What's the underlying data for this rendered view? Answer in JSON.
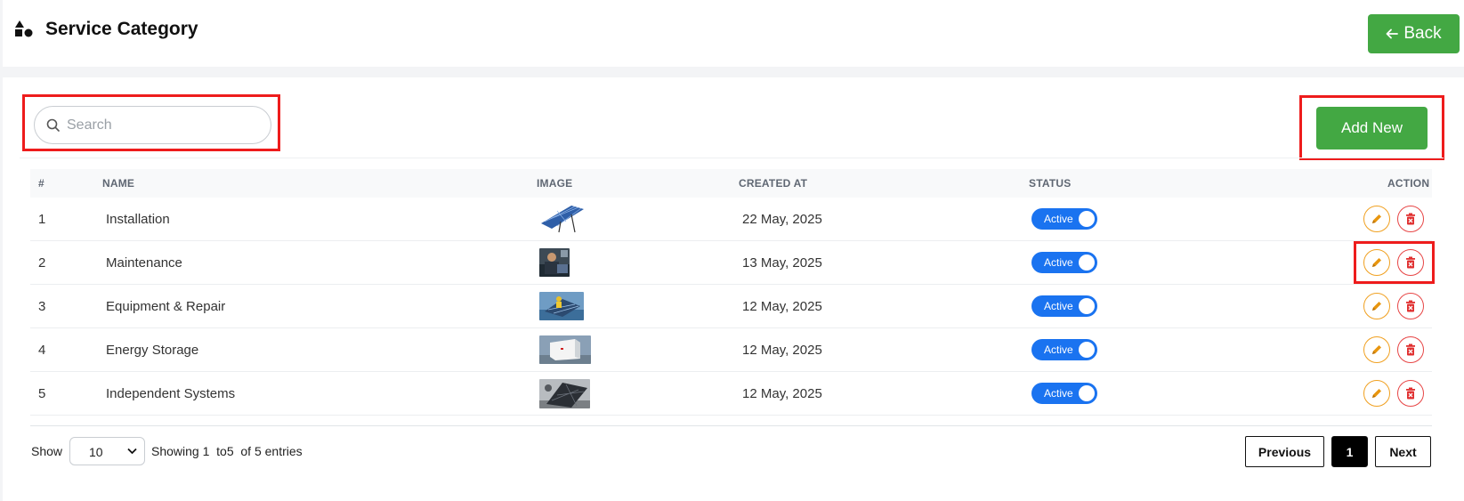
{
  "header": {
    "title": "Service Category",
    "back_label": "Back"
  },
  "toolbar": {
    "search_placeholder": "Search",
    "add_new_label": "Add New"
  },
  "table": {
    "columns": [
      "#",
      "NAME",
      "IMAGE",
      "CREATED AT",
      "STATUS",
      "ACTION"
    ],
    "rows": [
      {
        "index": "1",
        "name": "Installation",
        "created_at": "22 May, 2025",
        "status": "Active"
      },
      {
        "index": "2",
        "name": "Maintenance",
        "created_at": "13 May, 2025",
        "status": "Active"
      },
      {
        "index": "3",
        "name": "Equipment & Repair",
        "created_at": "12 May, 2025",
        "status": "Active"
      },
      {
        "index": "4",
        "name": "Energy Storage",
        "created_at": "12 May, 2025",
        "status": "Active"
      },
      {
        "index": "5",
        "name": "Independent Systems",
        "created_at": "12 May, 2025",
        "status": "Active"
      }
    ]
  },
  "footer": {
    "show_label": "Show",
    "page_size": "10",
    "entries_text": "Showing 1  to5  of 5 entries",
    "prev_label": "Previous",
    "current_page": "1",
    "next_label": "Next"
  },
  "colors": {
    "primary_green": "#43a843",
    "toggle_blue": "#1a73f0",
    "edit_orange": "#f0a020",
    "delete_red": "#e74545",
    "highlight_red": "#ee1c1c"
  },
  "icons": {
    "page": "shapes-icon",
    "back": "arrow-left-icon",
    "search": "search-icon",
    "edit": "pencil-icon",
    "delete": "trash-icon",
    "select": "chevron-down-icon"
  }
}
